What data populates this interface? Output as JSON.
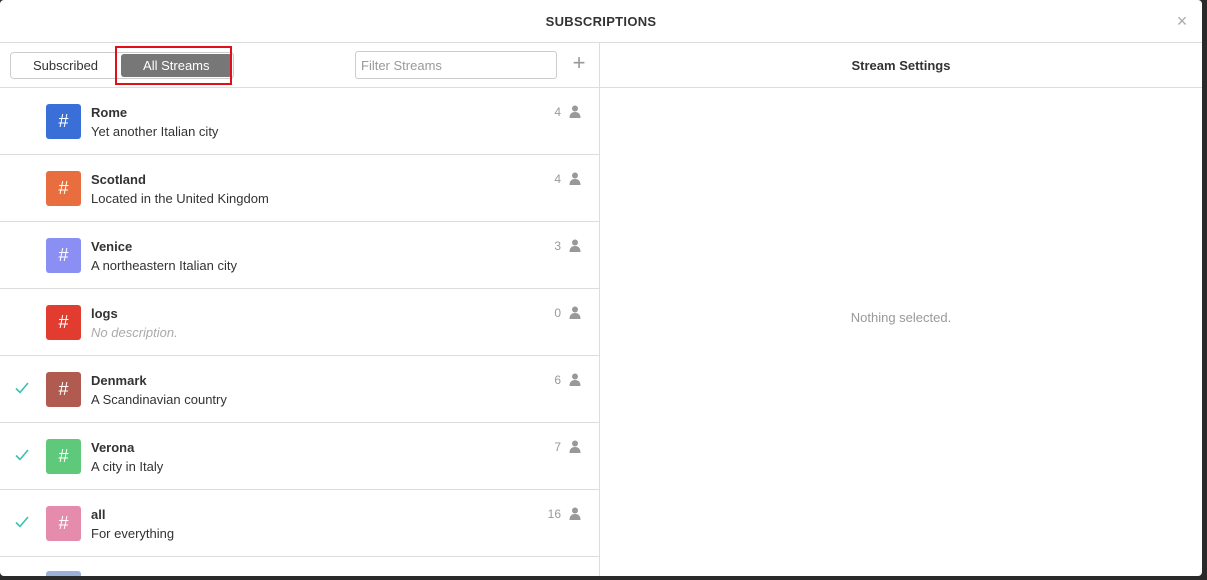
{
  "modal": {
    "title": "SUBSCRIPTIONS",
    "close_icon": "×"
  },
  "left_toolbar": {
    "tabs": [
      {
        "label": "Subscribed",
        "active": false
      },
      {
        "label": "All Streams",
        "active": true
      }
    ],
    "filter_placeholder": "Filter Streams",
    "add_icon": "+"
  },
  "streams": [
    {
      "name": "Rome",
      "description": "Yet another Italian city",
      "count": "4",
      "color": "#3a6fd8",
      "subscribed": false
    },
    {
      "name": "Scotland",
      "description": "Located in the United Kingdom",
      "count": "4",
      "color": "#e86d3f",
      "subscribed": false
    },
    {
      "name": "Venice",
      "description": "A northeastern Italian city",
      "count": "3",
      "color": "#8b8ff4",
      "subscribed": false
    },
    {
      "name": "logs",
      "description": "No description.",
      "count": "0",
      "color": "#e23b30",
      "subscribed": false,
      "empty_description": true
    },
    {
      "name": "Denmark",
      "description": "A Scandinavian country",
      "count": "6",
      "color": "#b05a50",
      "subscribed": true
    },
    {
      "name": "Verona",
      "description": "A city in Italy",
      "count": "7",
      "color": "#5ec97b",
      "subscribed": true
    },
    {
      "name": "all",
      "description": "For everything",
      "count": "16",
      "color": "#e58bac",
      "subscribed": true
    }
  ],
  "swatch_glyph": "#",
  "partial_next_color": "#9bb3d8",
  "right_panel": {
    "title": "Stream Settings",
    "empty_message": "Nothing selected."
  },
  "colors": {
    "check": "#3bc1b3",
    "active_tab": "#777777",
    "highlight": "#e0101a"
  }
}
